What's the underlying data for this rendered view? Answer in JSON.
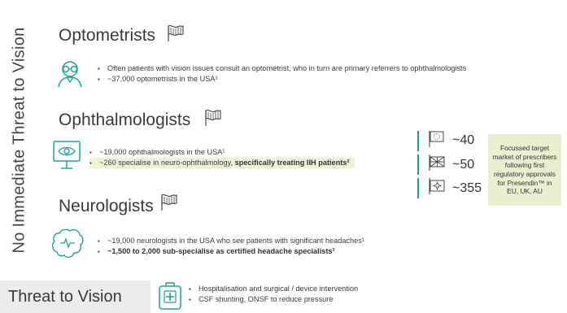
{
  "side_label": "No Immediate Threat to Vision",
  "optometrists": {
    "title": "Optometrists",
    "bullet1": "Often patients with vision issues consult an optometrist, who in turn are primary referrers to ophthalmologists",
    "bullet2": "~37,000 optometrists in the USA¹"
  },
  "ophthalmologists": {
    "title": "Ophthalmologists",
    "bullet1": "~19,000 ophthalmologists in the USA¹",
    "bullet2_pre": "~260 specialise in neuro-ophthalmology, ",
    "bullet2_bold": "specifically treating IIH patients²"
  },
  "neurologists": {
    "title": "Neurologists",
    "bullet1": "~19,000 neurologists in the USA who see patients with significant headaches¹",
    "bullet2": "~1,500 to 2,000 sub-specialise as certified headache specialists²"
  },
  "counts": [
    "~40",
    "~50",
    "~355"
  ],
  "target_box": "Focussed target market of prescribers following first regulatory approvals for Presendin™ in EU, UK, AU",
  "threat": {
    "title": "Threat to Vision",
    "bullet1": "Hospitalisation and surgical / device intervention",
    "bullet2": "CSF shunting, ONSF to reduce pressure"
  },
  "colors": {
    "teal": "#19a394",
    "highlight": "#eef3d6",
    "box": "#e9f0d0"
  },
  "icons": [
    "flag-icon",
    "optometrist-icon",
    "eye-monitor-icon",
    "brain-icon",
    "hospital-icon",
    "flag-eu-icon",
    "flag-uk-icon",
    "flag-au-icon"
  ]
}
